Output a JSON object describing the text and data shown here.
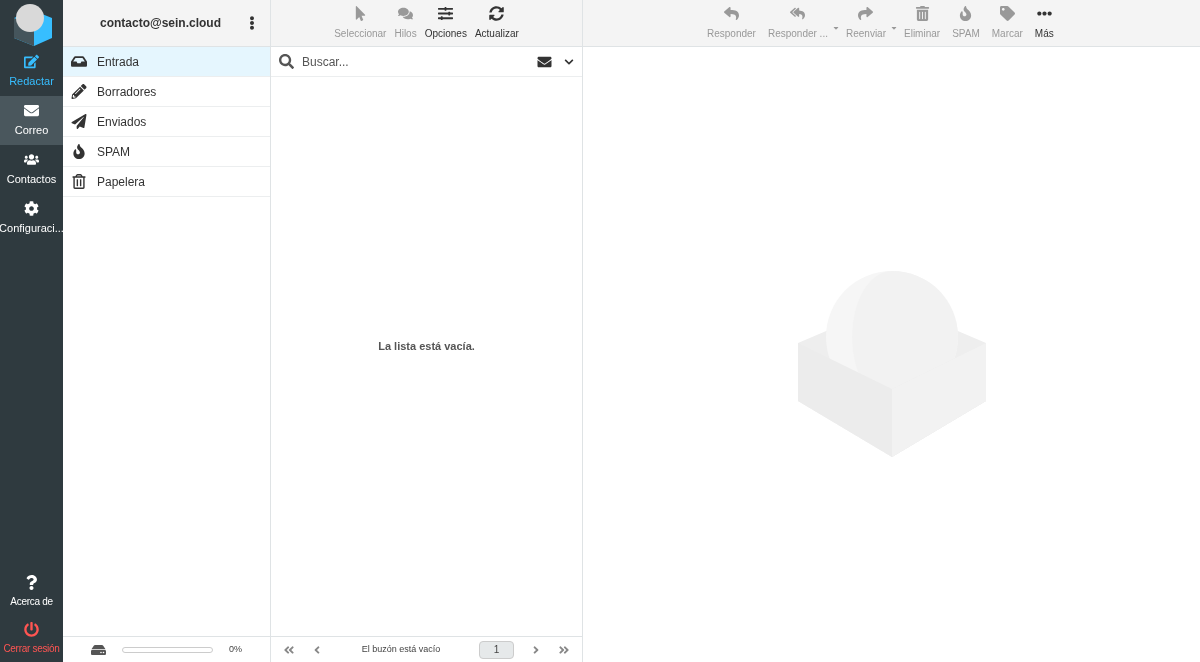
{
  "nav": [
    {
      "label": "Redactar",
      "kind": "compose",
      "selected": false
    },
    {
      "label": "Correo",
      "kind": "normal",
      "selected": true
    },
    {
      "label": "Contactos",
      "kind": "normal",
      "selected": false
    },
    {
      "label": "Configuraci...",
      "kind": "normal",
      "selected": false
    }
  ],
  "nav_bottom": [
    {
      "label": "Acerca de",
      "kind": "normal"
    },
    {
      "label": "Cerrar sesión",
      "kind": "logout"
    }
  ],
  "account": "contacto@sein.cloud",
  "folders": [
    {
      "label": "Entrada",
      "selected": true
    },
    {
      "label": "Borradores",
      "selected": false
    },
    {
      "label": "Enviados",
      "selected": false
    },
    {
      "label": "SPAM",
      "selected": false
    },
    {
      "label": "Papelera",
      "selected": false
    }
  ],
  "quota": {
    "level": 0,
    "reading": "0%"
  },
  "list_toolbar": [
    {
      "label": "Seleccionar",
      "disabled": true
    },
    {
      "label": "Hilos",
      "disabled": true
    },
    {
      "label": "Opciones",
      "disabled": false
    },
    {
      "label": "Actualizar",
      "disabled": false
    }
  ],
  "search": {
    "placeholder": "Buscar..."
  },
  "empty_list": "La lista está vacía.",
  "pager": {
    "status": "El buzón está vacío",
    "page": "1"
  },
  "message_toolbar": [
    {
      "label": "Responder",
      "disabled": true,
      "menu": false
    },
    {
      "label": "Responder ...",
      "disabled": true,
      "menu": true
    },
    {
      "label": "Reenviar",
      "disabled": true,
      "menu": true
    },
    {
      "label": "Eliminar",
      "disabled": true,
      "menu": false
    },
    {
      "label": "SPAM",
      "disabled": true,
      "menu": false
    },
    {
      "label": "Marcar",
      "disabled": true,
      "menu": false
    },
    {
      "label": "Más",
      "disabled": false,
      "menu": false
    }
  ]
}
